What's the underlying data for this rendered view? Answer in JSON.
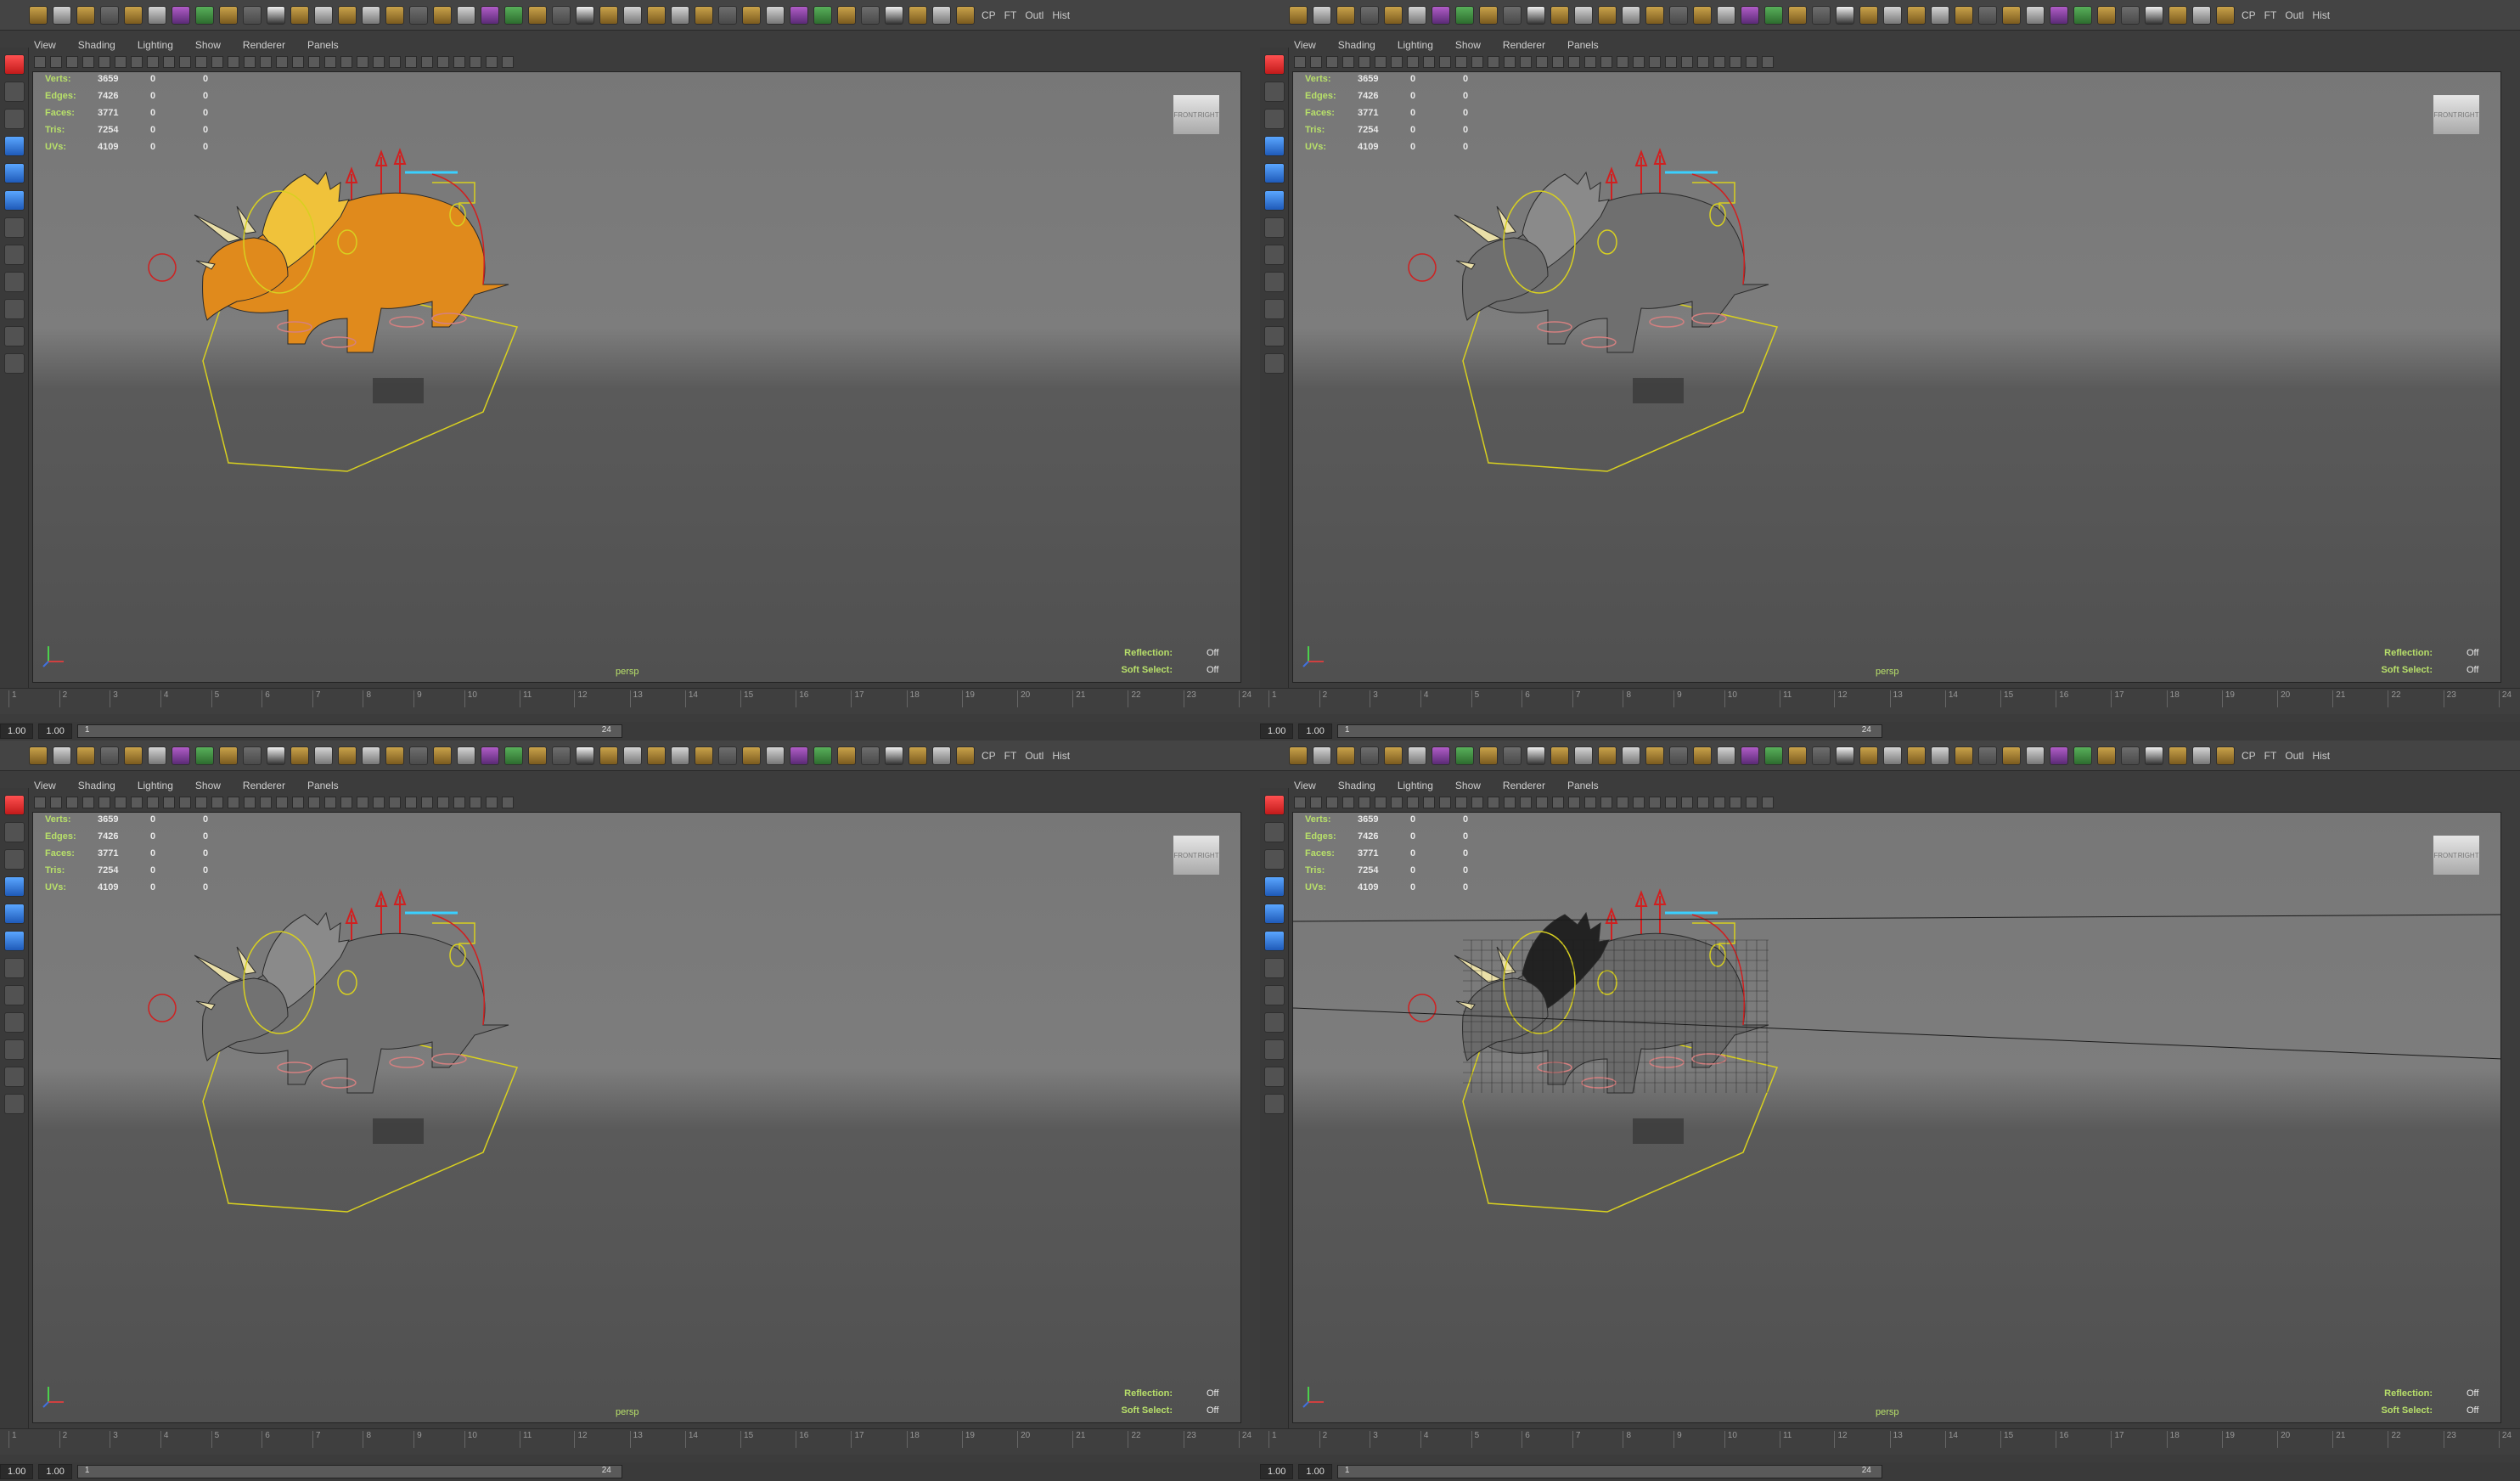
{
  "shelf": {
    "labels": [
      "CP",
      "FT",
      "Outl",
      "Hist"
    ]
  },
  "panel_menu": [
    "View",
    "Shading",
    "Lighting",
    "Show",
    "Renderer",
    "Panels"
  ],
  "hud": {
    "rows": [
      {
        "label": "Verts:",
        "v1": "3659",
        "v2": "0",
        "v3": "0"
      },
      {
        "label": "Edges:",
        "v1": "7426",
        "v2": "0",
        "v3": "0"
      },
      {
        "label": "Faces:",
        "v1": "3771",
        "v2": "0",
        "v3": "0"
      },
      {
        "label": "Tris:",
        "v1": "7254",
        "v2": "0",
        "v3": "0"
      },
      {
        "label": "UVs:",
        "v1": "4109",
        "v2": "0",
        "v3": "0"
      }
    ],
    "camera": "persp",
    "reflection_label": "Reflection:",
    "reflection_value": "Off",
    "soft_select_label": "Soft Select:",
    "soft_select_value": "Off",
    "viewcube_left": "FRONT",
    "viewcube_right": "RIGHT"
  },
  "timeline": {
    "ticks": [
      "1",
      "2",
      "3",
      "4",
      "5",
      "6",
      "7",
      "8",
      "9",
      "10",
      "11",
      "12",
      "13",
      "14",
      "15",
      "16",
      "17",
      "18",
      "19",
      "20",
      "21",
      "22",
      "23",
      "24"
    ]
  },
  "range": {
    "start": "1.00",
    "current": "1.00",
    "slider_start": "1",
    "slider_end": "24"
  },
  "panes": [
    {
      "shading": "textured",
      "body_color": "#e08a1c",
      "accent_color": "#f0c23a"
    },
    {
      "shading": "smooth-grey",
      "body_color": "#6f6f6f",
      "accent_color": "#8a8a8a"
    },
    {
      "shading": "smooth-grey",
      "body_color": "#727272",
      "accent_color": "#8a8a8a"
    },
    {
      "shading": "wireframe-on-shaded",
      "body_color": "#6a6a6a",
      "accent_color": "#222222"
    }
  ],
  "colors": {
    "hud_label": "#b8e06a",
    "rig_yellow": "#d8d020",
    "rig_red": "#d02020",
    "rig_cyan": "#3ad0ff"
  }
}
